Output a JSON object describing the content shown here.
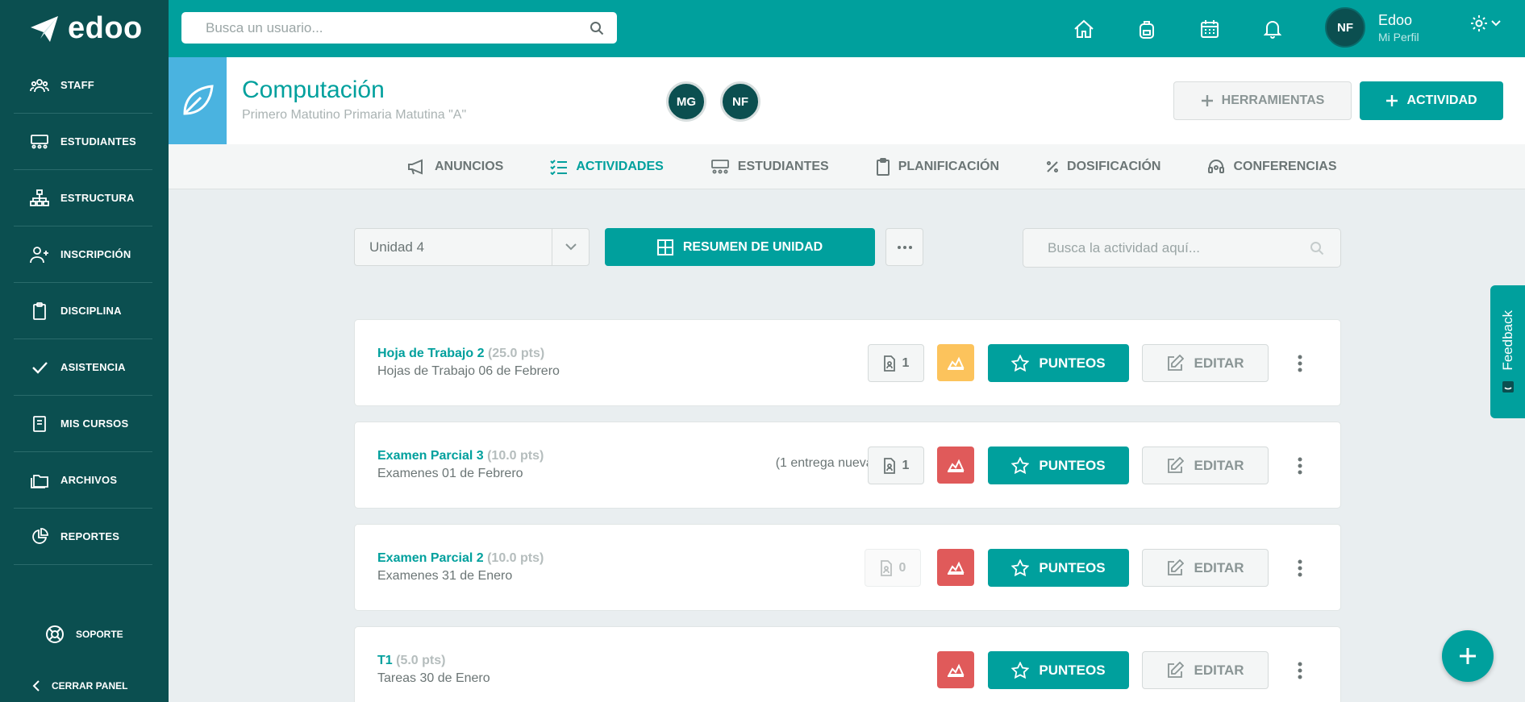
{
  "brand": {
    "name": "edoo"
  },
  "sidebar": {
    "items": [
      {
        "label": "STAFF",
        "icon": "users-icon"
      },
      {
        "label": "ESTUDIANTES",
        "icon": "students-icon"
      },
      {
        "label": "ESTRUCTURA",
        "icon": "hierarchy-icon"
      },
      {
        "label": "INSCRIPCIÓN",
        "icon": "user-plus-icon"
      },
      {
        "label": "DISCIPLINA",
        "icon": "clipboard-icon"
      },
      {
        "label": "ASISTENCIA",
        "icon": "check-icon"
      },
      {
        "label": "MIS CURSOS",
        "icon": "book-icon"
      },
      {
        "label": "ARCHIVOS",
        "icon": "folders-icon"
      },
      {
        "label": "REPORTES",
        "icon": "pie-chart-icon"
      }
    ],
    "support_label": "SOPORTE",
    "close_label": "CERRAR PANEL"
  },
  "topbar": {
    "search_placeholder": "Busca un usuario...",
    "profile": {
      "initials": "NF",
      "name": "Edoo",
      "subtitle": "Mi Perfil"
    }
  },
  "course": {
    "title": "Computación",
    "subtitle": "Primero Matutino Primaria Matutina \"A\"",
    "members": [
      "MG",
      "NF"
    ],
    "tools_label": "HERRAMIENTAS",
    "activity_label": "ACTIVIDAD"
  },
  "tabs": [
    {
      "label": "ANUNCIOS",
      "active": false
    },
    {
      "label": "ACTIVIDADES",
      "active": true
    },
    {
      "label": "ESTUDIANTES",
      "active": false
    },
    {
      "label": "PLANIFICACIÓN",
      "active": false
    },
    {
      "label": "DOSIFICACIÓN",
      "active": false
    },
    {
      "label": "CONFERENCIAS",
      "active": false
    }
  ],
  "controls": {
    "unit_value": "Unidad 4",
    "summary_label": "RESUMEN DE UNIDAD",
    "activity_search_placeholder": "Busca la actividad aquí..."
  },
  "activities": [
    {
      "title": "Hoja de Trabajo 2",
      "points": "(25.0 pts)",
      "subtitle": "Hojas de Trabajo 06 de Febrero",
      "new_note": "",
      "count": "1",
      "count_disabled": false,
      "chart_color": "#fcc35c",
      "punteos_label": "PUNTEOS",
      "editar_label": "EDITAR"
    },
    {
      "title": "Examen Parcial 3",
      "points": "(10.0 pts)",
      "subtitle": "Examenes 01 de Febrero",
      "new_note": "(1 entrega nueva)",
      "count": "1",
      "count_disabled": false,
      "chart_color": "#e05a5a",
      "punteos_label": "PUNTEOS",
      "editar_label": "EDITAR"
    },
    {
      "title": "Examen Parcial 2",
      "points": "(10.0 pts)",
      "subtitle": "Examenes 31 de Enero",
      "new_note": "",
      "count": "0",
      "count_disabled": true,
      "chart_color": "#e05a5a",
      "punteos_label": "PUNTEOS",
      "editar_label": "EDITAR"
    },
    {
      "title": "T1",
      "points": "(5.0 pts)",
      "subtitle": "Tareas 30 de Enero",
      "new_note": "",
      "count": "",
      "count_disabled": false,
      "chart_color": "#e05a5a",
      "punteos_label": "PUNTEOS",
      "editar_label": "EDITAR"
    }
  ],
  "feedback_label": "Feedback",
  "colors": {
    "accent": "#00a09d",
    "sidebar": "#0b4f50",
    "warning": "#fcc35c",
    "danger": "#e05a5a"
  }
}
